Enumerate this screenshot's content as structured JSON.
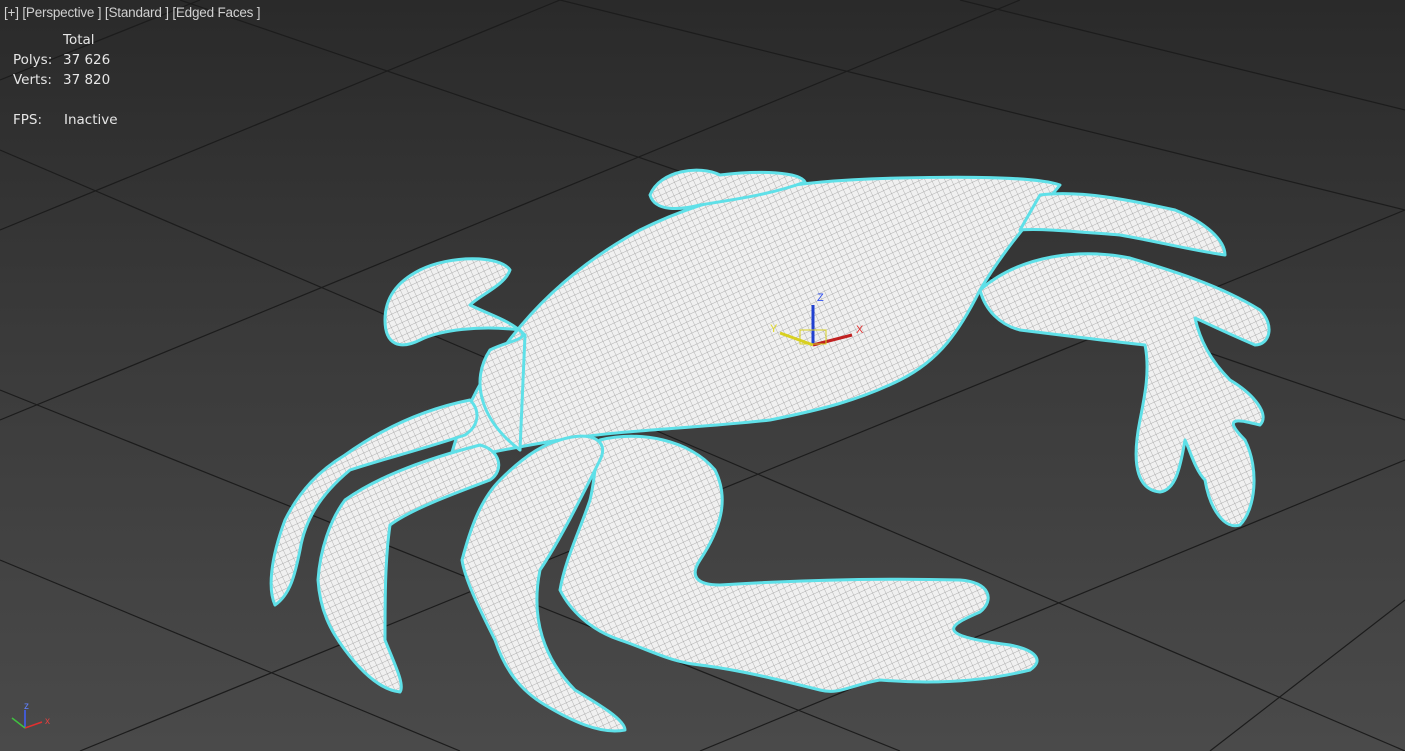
{
  "viewport": {
    "label_plus": "[+]",
    "label_view": "[Perspective ]",
    "label_shading": "[Standard ]",
    "label_edges": "[Edged Faces ]"
  },
  "stats": {
    "header": "Total",
    "polys_label": "Polys:",
    "polys_value": "37 626",
    "verts_label": "Verts:",
    "verts_value": "37 820",
    "fps_label": "FPS:",
    "fps_value": "Inactive"
  },
  "gizmo": {
    "x_label": "X",
    "y_label": "Y",
    "z_label": "Z",
    "x_color": "#c02020",
    "y_color": "#d8d020",
    "z_color": "#2040d0"
  },
  "axis_tripod": {
    "x_label": "x",
    "y_label": "y",
    "z_label": "z"
  },
  "colors": {
    "selection_outline": "#5fe0e8",
    "mesh_fill": "#e8e8e8",
    "wire": "#9a9a9a",
    "grid": "#1a1a1a"
  }
}
